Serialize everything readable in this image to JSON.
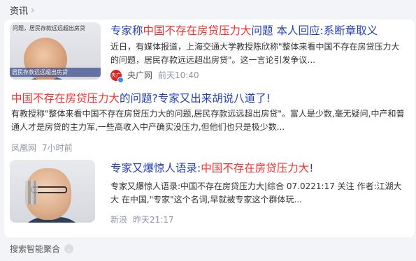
{
  "section": {
    "label": "资讯"
  },
  "results": [
    {
      "title_parts": [
        "专家称",
        "中国不存在房贷压力大",
        "问题 本人回应:系断章取义"
      ],
      "snippet": "近日，有媒体报道，上海交通大学教授陈欣称\"整体来看中国不存在房贷压力大的问题，居民存款远远超出房贷\"。这一言论引发争议...",
      "thumb_caption": "问题，居民存款远远超出房贷",
      "thumb_banner": "居民存款远远超出房贷",
      "source": "央广网",
      "source_icon": "央广",
      "time": "前天10:40"
    },
    {
      "title_parts": [
        "中国不存在房贷压力大",
        "的问题?专家又出来胡说八道了!"
      ],
      "snippet": "有教授称\"整体来看中国不存在房贷压力大的问题,居民存款远远超出房贷\"。富人是少数,毫无疑问,中产和普通人才是房贷的主力军,一些高收入中产确实没压力,但他们也只是极少数...",
      "source": "凤凰网",
      "time": "7小时前"
    },
    {
      "title_parts": [
        "专家又爆惊人语录:",
        "中国不存在房贷压力大",
        "!"
      ],
      "snippet": "专家又爆惊人语录:中国不存在房贷压力大|综合 07.0221:17 关注 作者:江湖大大 在中国,\"专家\"这个名词,早就被专家这个群体玩...",
      "source": "新浪",
      "time": "昨天21:17"
    }
  ],
  "footer": {
    "label": "搜索智能聚合"
  }
}
